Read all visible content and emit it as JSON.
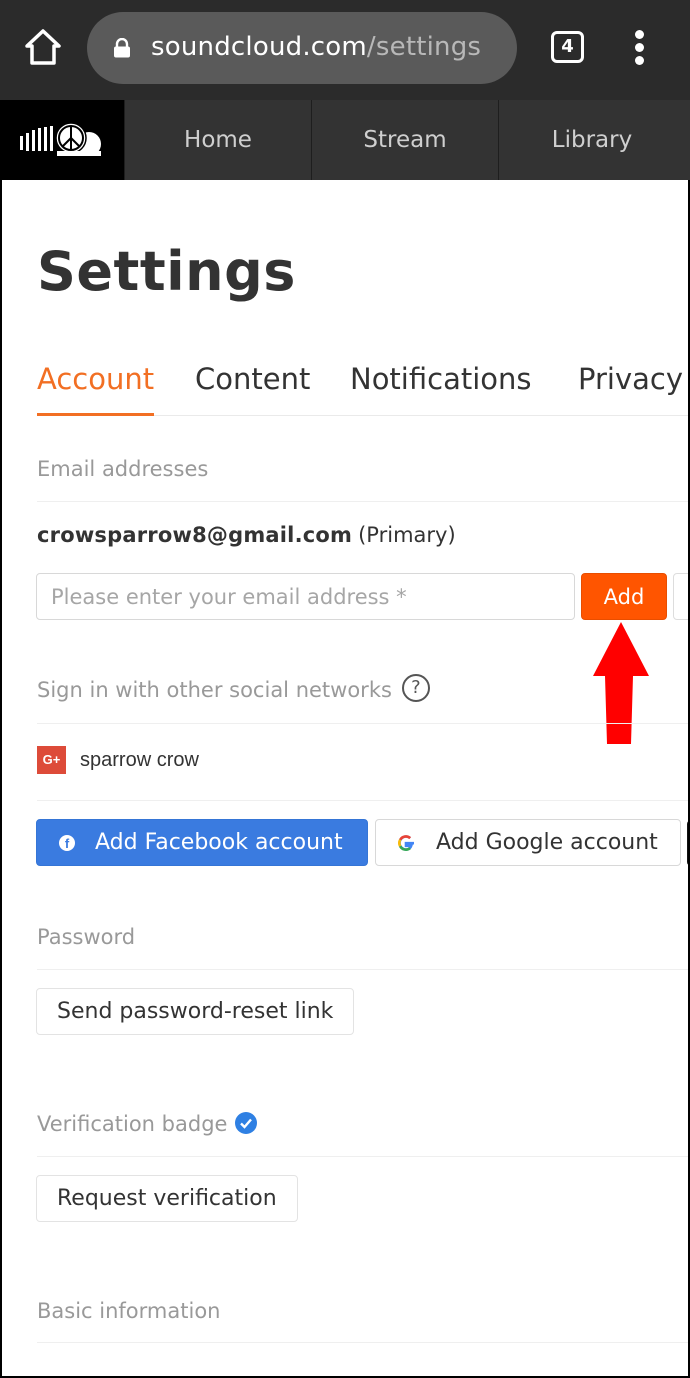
{
  "browser": {
    "url_host": "soundcloud.com",
    "url_path": "/settings",
    "tab_count": "4",
    "icons": {
      "home": "home-icon",
      "lock": "lock-icon",
      "menu": "more-vert-icon"
    }
  },
  "nav": {
    "logo": "soundcloud-peace-logo",
    "items": [
      {
        "label": "Home"
      },
      {
        "label": "Stream"
      },
      {
        "label": "Library"
      }
    ]
  },
  "page": {
    "title": "Settings",
    "tabs": [
      {
        "label": "Account",
        "active": true
      },
      {
        "label": "Content",
        "active": false
      },
      {
        "label": "Notifications",
        "active": false
      },
      {
        "label": "Privacy",
        "active": false
      }
    ],
    "email": {
      "section_label": "Email addresses",
      "primary_address": "crowsparrow8@gmail.com",
      "primary_tag": "(Primary)",
      "input_placeholder": "Please enter your email address *",
      "input_value": "",
      "add_label": "Add"
    },
    "social": {
      "section_label": "Sign in with other social networks",
      "help_glyph": "?",
      "connected": [
        {
          "network": "Google+",
          "badge": "G+",
          "name": "sparrow crow"
        }
      ],
      "facebook_label": "Add Facebook account",
      "google_label": "Add Google account"
    },
    "password": {
      "section_label": "Password",
      "reset_label": "Send password-reset link"
    },
    "verification": {
      "section_label": "Verification badge",
      "request_label": "Request verification"
    },
    "basic_info": {
      "section_label": "Basic information"
    }
  },
  "colors": {
    "accent": "#f26f23",
    "add_button": "#ff5500",
    "facebook": "#3a7be0",
    "google_plus": "#dd4b39",
    "annotation_arrow": "#ff0000",
    "verified": "#2f80e3"
  }
}
